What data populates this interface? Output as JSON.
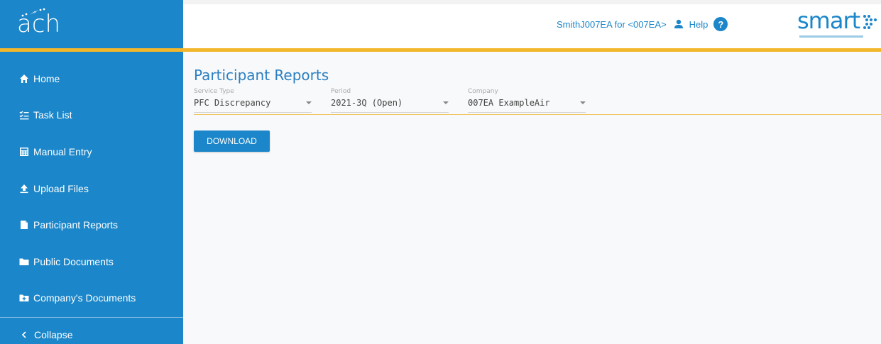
{
  "app": {
    "logo_text": "ach",
    "brand_color": "#1b86c9",
    "accent_color": "#f3b72b"
  },
  "header": {
    "user_label": "SmithJ007EA for <007EA>",
    "user_icon": "person-icon",
    "help_label": "Help",
    "help_icon": "question-circle-icon",
    "smart_logo_text": "smart"
  },
  "sidebar": {
    "items": [
      {
        "label": "Home",
        "icon": "home-icon"
      },
      {
        "label": "Task List",
        "icon": "checklist-icon"
      },
      {
        "label": "Manual Entry",
        "icon": "calculator-icon"
      },
      {
        "label": "Upload Files",
        "icon": "upload-icon"
      },
      {
        "label": "Participant Reports",
        "icon": "report-icon"
      },
      {
        "label": "Public Documents",
        "icon": "folder-icon"
      },
      {
        "label": "Company's Documents",
        "icon": "folder-plus-icon"
      }
    ],
    "collapse_label": "Collapse"
  },
  "main": {
    "title": "Participant Reports",
    "filters": {
      "service_type": {
        "label": "Service Type",
        "value": "PFC Discrepancy"
      },
      "period": {
        "label": "Period",
        "value": "2021-3Q (Open)"
      },
      "company": {
        "label": "Company",
        "value": "007EA ExampleAir"
      }
    },
    "download_label": "DOWNLOAD"
  }
}
